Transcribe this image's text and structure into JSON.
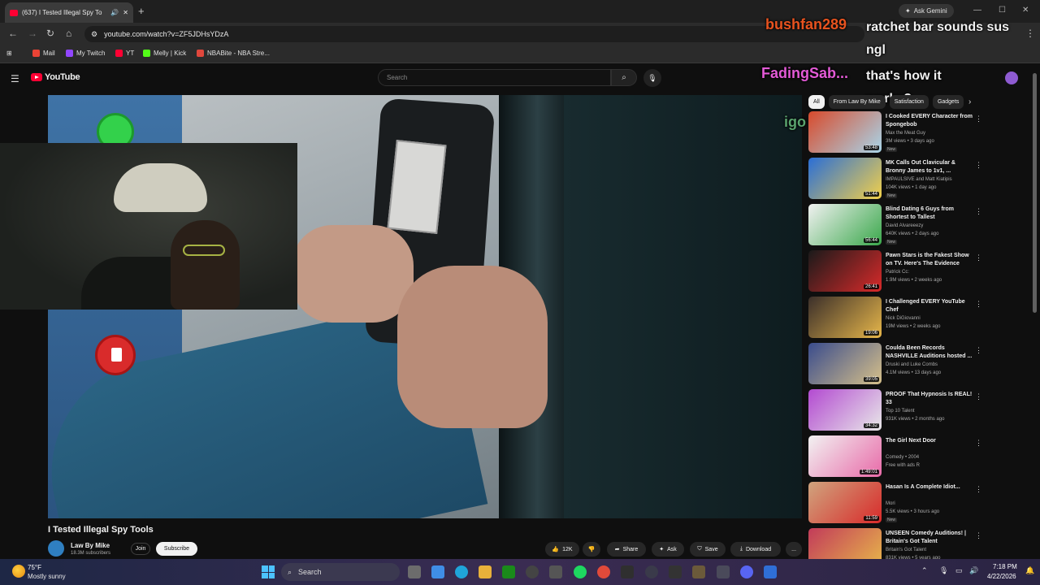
{
  "browser": {
    "tab_title": "(637) I Tested Illegal Spy To",
    "new_tab_symbol": "+",
    "ask_gemini": "Ask Gemini",
    "url": "youtube.com/watch?v=ZF5JDHsYDzA",
    "bookmarks": [
      {
        "label": "Mail",
        "color": "#ea4335"
      },
      {
        "label": "My Twitch",
        "color": "#9146ff"
      },
      {
        "label": "YT",
        "color": "#ff0033"
      },
      {
        "label": "Melly | Kick",
        "color": "#53fc18"
      },
      {
        "label": "NBABite - NBA Stre...",
        "color": "#e0473c"
      }
    ]
  },
  "youtube": {
    "logo_text": "YouTube",
    "search_placeholder": "Search",
    "search_icon": "search-icon",
    "mic_icon": "mic-icon"
  },
  "chat": [
    {
      "user": "bushfan289",
      "user_color": "#e8531f",
      "message": "ratchet bar sounds sus ngl"
    },
    {
      "user": "FadingSab...",
      "user_color": "#e35ad6",
      "message": "that's how it works?"
    },
    {
      "user": "igo",
      "user_color": "#5aa36e",
      "message": ""
    }
  ],
  "video": {
    "title": "I Tested Illegal Spy Tools",
    "channel": "Law By Mike",
    "subscribers": "18.3M subscribers",
    "join": "Join",
    "subscribe": "Subscribe",
    "likes": "12K",
    "share": "Share",
    "ask": "Ask",
    "save": "Save",
    "download": "Download",
    "more": "..."
  },
  "chips": [
    "All",
    "From Law By Mike",
    "Satisfaction",
    "Gadgets"
  ],
  "recommendations": [
    {
      "title": "I Cooked EVERY Character from Spongebob",
      "channel": "Max the Meat Guy",
      "meta": "3M views • 3 days ago",
      "badge": "New",
      "duration": "53:48",
      "thumb": [
        "#d84a2c",
        "#a8d6ea"
      ]
    },
    {
      "title": "MK Calls Out Clavicular & Bronny James to 1v1, ...",
      "channel": "IMPAULSIVE and Matt Kiatipis",
      "meta": "104K views • 1 day ago",
      "badge": "New",
      "duration": "51:44",
      "thumb": [
        "#2a6ed6",
        "#f2d04a"
      ]
    },
    {
      "title": "Blind Dating 6 Guys from Shortest to Tallest",
      "channel": "David Alvareeezy",
      "meta": "640K views • 2 days ago",
      "badge": "New",
      "duration": "56:44",
      "thumb": [
        "#f1f1f1",
        "#3aa84b"
      ]
    },
    {
      "title": "Pawn Stars is the Fakest Show on TV. Here's The Evidence",
      "channel": "Patrick Cc:",
      "meta": "1.9M views • 2 weeks ago",
      "badge": "",
      "duration": "26:41",
      "thumb": [
        "#1a1a1a",
        "#d82a2a"
      ]
    },
    {
      "title": "I Challenged EVERY YouTube Chef",
      "channel": "Nick DiGiovanni",
      "meta": "19M views • 2 weeks ago",
      "badge": "",
      "duration": "19:06",
      "thumb": [
        "#3b2f2a",
        "#e6b64a"
      ]
    },
    {
      "title": "Coulda Been Records NASHVILLE Auditions hosted ...",
      "channel": "Druski and Luke Combs",
      "meta": "4.1M views • 13 days ago",
      "badge": "",
      "duration": "39:05",
      "thumb": [
        "#3a4c8c",
        "#d6c08a"
      ]
    },
    {
      "title": "PROOF That Hypnosis Is REAL! 33",
      "channel": "Top 10 Talent",
      "meta": "931K views • 2 months ago",
      "badge": "",
      "duration": "34:32",
      "thumb": [
        "#b34ad1",
        "#e8e8e8"
      ]
    },
    {
      "title": "The Girl Next Door",
      "channel": "Comedy • 2004",
      "meta": "Free with ads  R",
      "badge": "",
      "duration": "1:49:01",
      "thumb": [
        "#f2f2f2",
        "#e86aa8"
      ]
    },
    {
      "title": "Hasan Is A Complete Idiot...",
      "channel": "Mori",
      "meta": "5.5K views • 3 hours ago",
      "badge": "New",
      "duration": "11:59",
      "thumb": [
        "#d0a47e",
        "#d82a2a"
      ]
    },
    {
      "title": "UNSEEN Comedy Auditions! | Britain's Got Talent",
      "channel": "Britain's Got Talent",
      "meta": "831K views • 5 years ago",
      "badge": "",
      "duration": "22:29",
      "thumb": [
        "#c23b5a",
        "#e8b84a"
      ]
    }
  ],
  "taskbar": {
    "temp": "75°F",
    "weather": "Mostly sunny",
    "search": "Search",
    "time": "7:18 PM",
    "date": "4/22/2026"
  },
  "colors": {
    "accent": "#ff0033",
    "page_bg": "#0f0f0f"
  }
}
